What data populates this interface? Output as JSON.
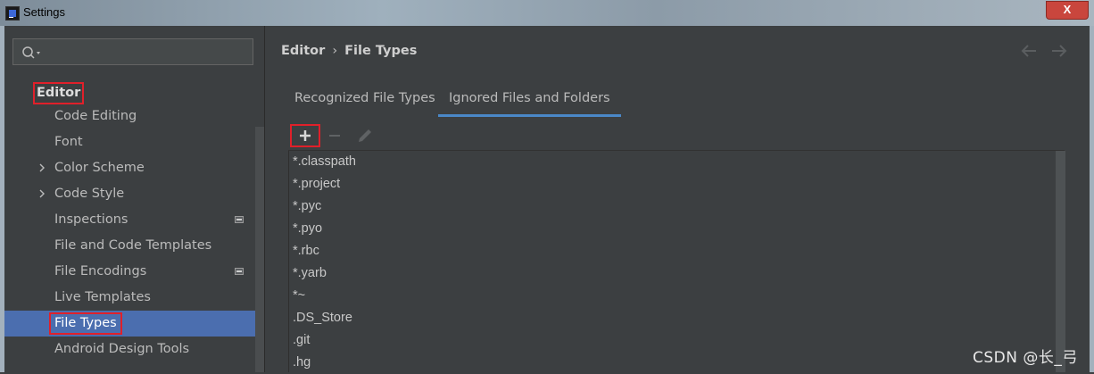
{
  "window": {
    "title": "Settings",
    "close_label": "X"
  },
  "sidebar": {
    "search_placeholder": "",
    "editor_heading": "Editor",
    "items": [
      {
        "label": "Code Editing",
        "expandable": false,
        "project_icon": false,
        "selected": false
      },
      {
        "label": "Font",
        "expandable": false,
        "project_icon": false,
        "selected": false
      },
      {
        "label": "Color Scheme",
        "expandable": true,
        "project_icon": false,
        "selected": false
      },
      {
        "label": "Code Style",
        "expandable": true,
        "project_icon": false,
        "selected": false
      },
      {
        "label": "Inspections",
        "expandable": false,
        "project_icon": true,
        "selected": false
      },
      {
        "label": "File and Code Templates",
        "expandable": false,
        "project_icon": false,
        "selected": false
      },
      {
        "label": "File Encodings",
        "expandable": false,
        "project_icon": true,
        "selected": false
      },
      {
        "label": "Live Templates",
        "expandable": false,
        "project_icon": false,
        "selected": false
      },
      {
        "label": "File Types",
        "expandable": false,
        "project_icon": false,
        "selected": true
      },
      {
        "label": "Android Design Tools",
        "expandable": false,
        "project_icon": false,
        "selected": false
      }
    ]
  },
  "main": {
    "breadcrumb": {
      "parent": "Editor",
      "separator": "›",
      "current": "File Types"
    },
    "tabs": [
      {
        "label": "Recognized File Types",
        "active": false
      },
      {
        "label": "Ignored Files and Folders",
        "active": true
      }
    ],
    "toolbar": {
      "add_icon": "plus-icon",
      "remove_icon": "minus-icon",
      "edit_icon": "pencil-icon"
    },
    "ignored_patterns": [
      "*.classpath",
      "*.project",
      "*.pyc",
      "*.pyo",
      "*.rbc",
      "*.yarb",
      "*~",
      ".DS_Store",
      ".git",
      ".hg"
    ]
  },
  "watermark": "CSDN @长_弓",
  "colors": {
    "background": "#3c3f41",
    "selection": "#4b6eaf",
    "tab_underline": "#4a88c7",
    "annotation_red": "#e0202a"
  }
}
